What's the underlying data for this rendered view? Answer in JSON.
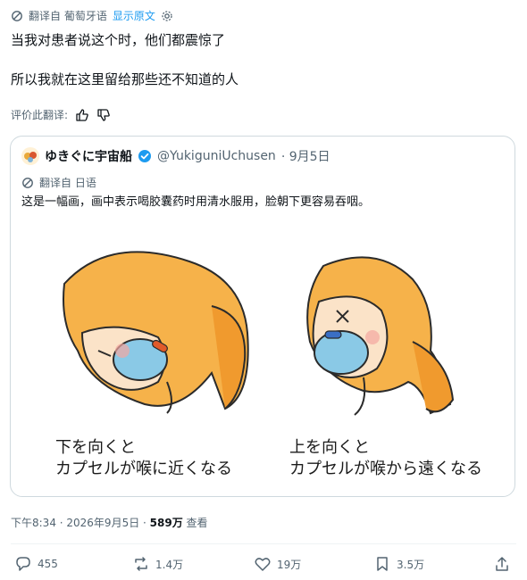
{
  "translation_bar": {
    "translated_from": "翻译自 葡萄牙语",
    "show_original": "显示原文"
  },
  "tweet": {
    "line1": "当我对患者说这个时，他们都震惊了",
    "line2": "所以我就在这里留给那些还不知道的人"
  },
  "rate": {
    "label": "评价此翻译:"
  },
  "quote": {
    "display_name": "ゆきぐに宇宙船",
    "handle": "@YukiguniUchusen",
    "date": "· 9月5日",
    "translated_from": "翻译自 日语",
    "text": "这是一幅画，画中表示喝胶囊药时用清水服用，脸朝下更容易吞咽。",
    "caption_left_1": "下を向くと",
    "caption_left_2": "カプセルが喉に近くなる",
    "caption_right_1": "上を向くと",
    "caption_right_2": "カプセルが喉から遠くなる"
  },
  "meta": {
    "time": "下午8:34 · 2026年9月5日 · ",
    "views": "589万",
    "views_label": " 查看"
  },
  "actions": {
    "replies": "455",
    "reposts": "1.4万",
    "likes": "19万",
    "bookmarks": "3.5万"
  },
  "colors": {
    "accent": "#1d9bf0",
    "text": "#0f1419",
    "muted": "#536471",
    "border": "#cfd9de"
  }
}
